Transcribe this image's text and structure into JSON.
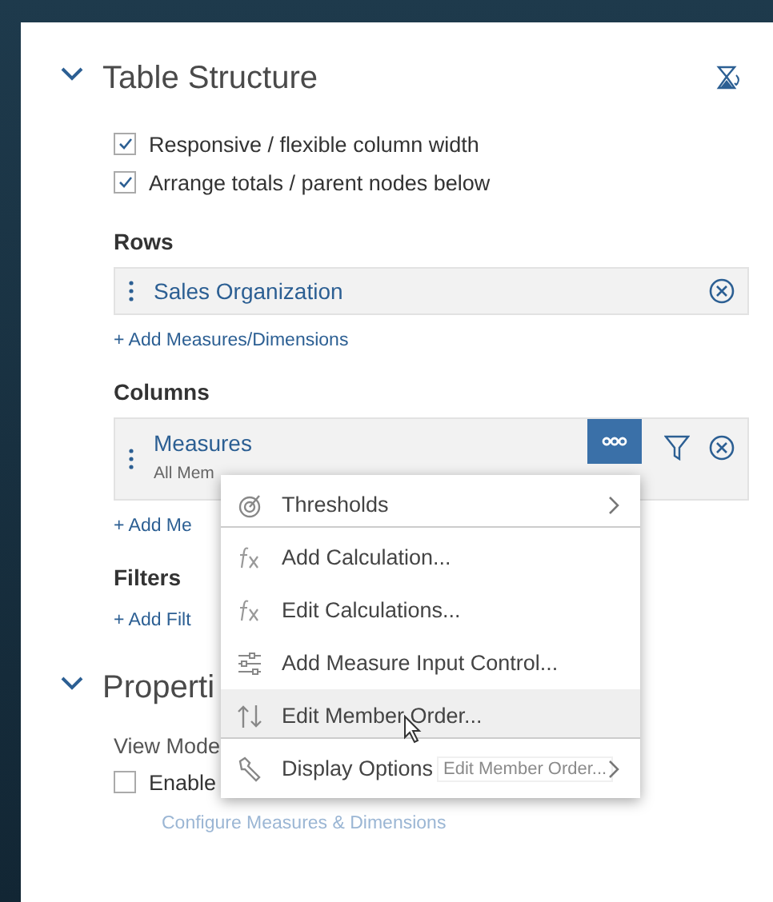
{
  "table_structure": {
    "title": "Table Structure",
    "expanded": true,
    "options": [
      {
        "label": "Responsive / flexible column width",
        "checked": true
      },
      {
        "label": "Arrange totals / parent nodes below",
        "checked": true
      }
    ],
    "rows": {
      "label": "Rows",
      "items": [
        {
          "name": "Sales Organization"
        }
      ],
      "add_link": "+ Add Measures/Dimensions"
    },
    "columns": {
      "label": "Columns",
      "items": [
        {
          "name": "Measures",
          "subtitle": "All Mem"
        }
      ],
      "add_link": "+ Add Me"
    },
    "filters": {
      "label": "Filters",
      "add_link": "+ Add Filt"
    }
  },
  "properties": {
    "title": "Properti",
    "expanded": true,
    "view_mode_label": "View Mode",
    "options": [
      {
        "label": "Enable",
        "checked": false
      }
    ],
    "link": "Configure Measures & Dimensions"
  },
  "context_menu": {
    "items": [
      {
        "label": "Thresholds",
        "kind": "threshold",
        "submenu": true,
        "separator_after": true,
        "hovered": false
      },
      {
        "label": "Add Calculation...",
        "kind": "calculation",
        "submenu": false,
        "separator_after": false,
        "hovered": false
      },
      {
        "label": "Edit Calculations...",
        "kind": "calculation",
        "submenu": false,
        "separator_after": false,
        "hovered": false
      },
      {
        "label": "Add Measure Input Control...",
        "kind": "input-control",
        "submenu": false,
        "separator_after": false,
        "hovered": false
      },
      {
        "label": "Edit Member Order...",
        "kind": "sort",
        "submenu": false,
        "separator_after": true,
        "hovered": true
      },
      {
        "label": "Display Options",
        "kind": "options",
        "submenu": true,
        "separator_after": false,
        "hovered": false
      }
    ],
    "tooltip": "Edit Member Order..."
  }
}
